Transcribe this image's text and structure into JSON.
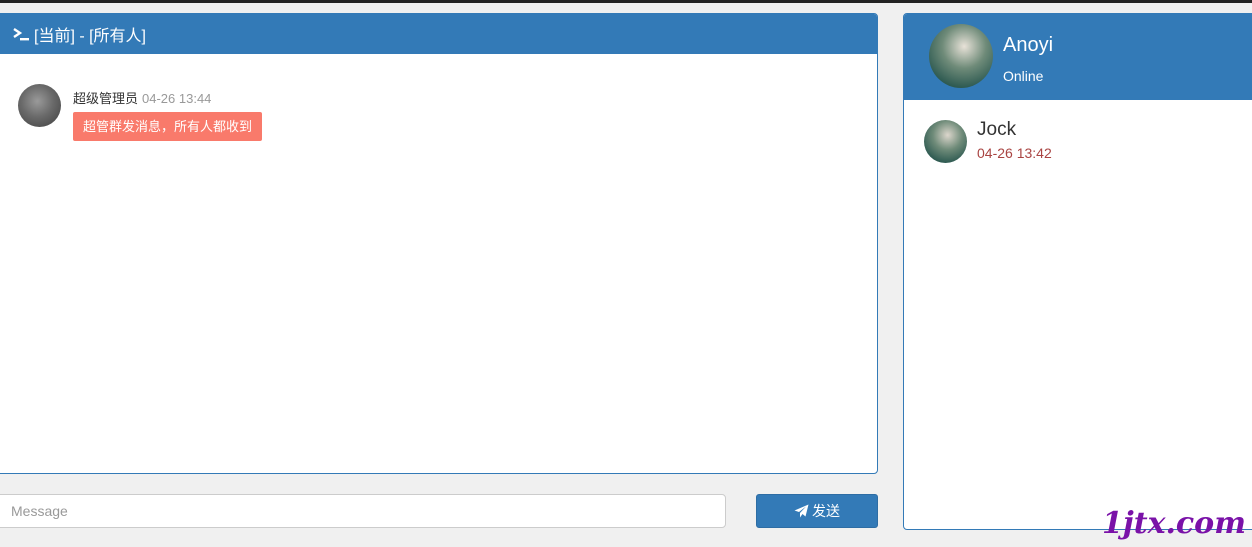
{
  "chat": {
    "header_title": "[当前] - [所有人]",
    "messages": [
      {
        "sender": "超级管理员",
        "time": "04-26 13:44",
        "text": "超管群发消息，所有人都收到"
      }
    ]
  },
  "composer": {
    "placeholder": "Message",
    "value": "",
    "send_label": "发送"
  },
  "current_user": {
    "name": "Anoyi",
    "status": "Online"
  },
  "contacts": [
    {
      "name": "Jock",
      "time": "04-26 13:42"
    }
  ],
  "watermark": "1jtx.com",
  "colors": {
    "primary": "#337ab7",
    "bubble": "#f97a6b",
    "contact_time": "#a94442"
  },
  "icons": {
    "header": "terminal-icon",
    "send": "paper-plane-icon"
  }
}
